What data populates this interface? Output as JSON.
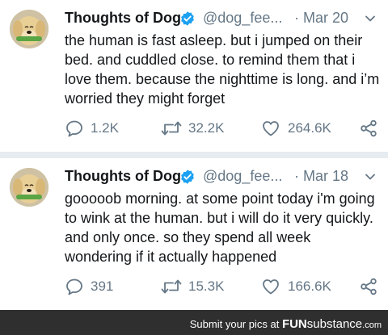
{
  "tweets": [
    {
      "display_name": "Thoughts of Dog",
      "handle": "@dog_fee...",
      "date": "· Mar 20",
      "text": "the human is fast asleep. but i jumped on their bed. and cuddled close. to remind them that i love them. because the nighttime is long. and i’m worried they might forget",
      "replies": "1.2K",
      "retweets": "32.2K",
      "likes": "264.6K"
    },
    {
      "display_name": "Thoughts of Dog",
      "handle": "@dog_fee...",
      "date": "· Mar 18",
      "text": "gooooob morning. at some point today i'm going to wink at the human. but i will do it very quickly. and only once. so they spend all week wondering if it actually happened",
      "replies": "391",
      "retweets": "15.3K",
      "likes": "166.6K"
    }
  ],
  "footer": {
    "text": "Submit your pics at",
    "brand_fun": "FUN",
    "brand_rest": "substance",
    "brand_tld": ".com"
  },
  "colors": {
    "verified": "#1da1f2",
    "secondary_text": "#657786",
    "footer_bg": "#2f2f2f"
  },
  "icons": [
    "verified-badge-icon",
    "chevron-down-icon",
    "reply-icon",
    "retweet-icon",
    "heart-icon",
    "share-icon"
  ]
}
